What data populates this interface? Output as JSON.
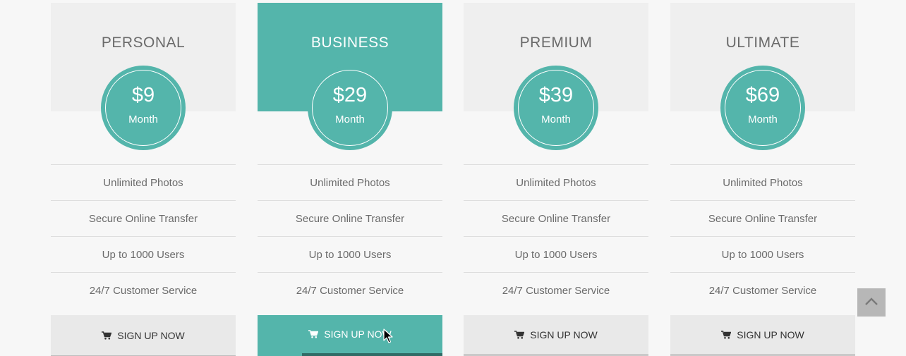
{
  "colors": {
    "accent": "#54b5ab",
    "header_bg": "#efefef",
    "button_bg": "#e9e9e9",
    "scroll_button": "#b7b7b7"
  },
  "plans": [
    {
      "name": "PERSONAL",
      "price": "$9",
      "period": "Month",
      "features": [
        "Unlimited Photos",
        "Secure Online Transfer",
        "Up to 1000 Users",
        "24/7 Customer Service"
      ],
      "button_label": "SIGN UP NOW",
      "button_icon": "shopping-cart-icon"
    },
    {
      "name": "BUSINESS",
      "price": "$29",
      "period": "Month",
      "features": [
        "Unlimited Photos",
        "Secure Online Transfer",
        "Up to 1000 Users",
        "24/7 Customer Service"
      ],
      "button_label": "SIGN UP NOW",
      "button_icon": "shopping-cart-icon"
    },
    {
      "name": "PREMIUM",
      "price": "$39",
      "period": "Month",
      "features": [
        "Unlimited Photos",
        "Secure Online Transfer",
        "Up to 1000 Users",
        "24/7 Customer Service"
      ],
      "button_label": "SIGN UP NOW",
      "button_icon": "shopping-cart-icon"
    },
    {
      "name": "ULTIMATE",
      "price": "$69",
      "period": "Month",
      "features": [
        "Unlimited Photos",
        "Secure Online Transfer",
        "Up to 1000 Users",
        "24/7 Customer Service"
      ],
      "button_label": "SIGN UP NOW",
      "button_icon": "shopping-cart-icon"
    }
  ],
  "scroll_top": {
    "icon": "chevron-up-icon"
  },
  "cursor": {
    "icon": "mouse-pointer-icon"
  }
}
